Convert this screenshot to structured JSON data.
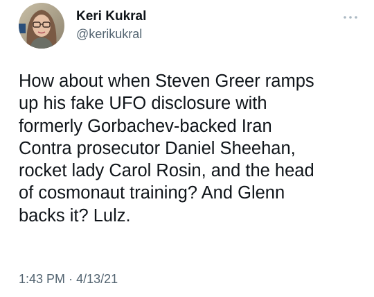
{
  "author": {
    "display_name": "Keri Kukral",
    "handle": "@kerikukral"
  },
  "tweet": {
    "lines": [
      "How about when Steven Greer ramps",
      "up his fake UFO disclosure with",
      "formerly Gorbachev-backed Iran",
      "Contra prosecutor Daniel Sheehan,",
      "rocket lady Carol Rosin, and the head",
      "of cosmonaut training? And Glenn",
      "backs it? Lulz."
    ]
  },
  "meta": {
    "time": "1:43 PM",
    "separator": "·",
    "date": "4/13/21"
  },
  "icons": {
    "more": "more-horizontal-icon",
    "avatar": "profile-photo"
  },
  "colors": {
    "text": "#0f1419",
    "secondary": "#536471",
    "icon": "#aab8c2"
  }
}
